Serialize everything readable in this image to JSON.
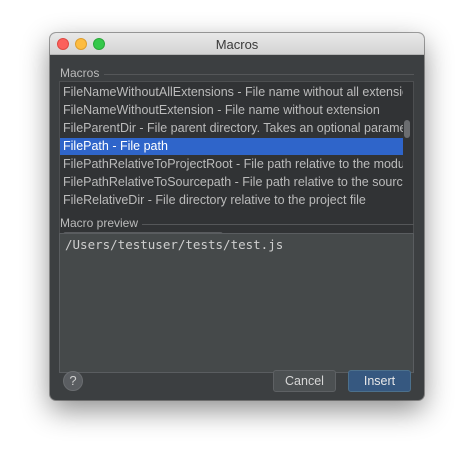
{
  "window": {
    "title": "Macros"
  },
  "macros": {
    "label": "Macros",
    "items": [
      "FileNameWithoutAllExtensions - File name without all extensio",
      "FileNameWithoutExtension - File name without extension",
      "FileParentDir - File parent directory. Takes an optional paramet",
      "FilePath - File path",
      "FilePathRelativeToProjectRoot - File path relative to the module",
      "FilePathRelativeToSourcepath - File path relative to the source",
      "FileRelativeDir - File directory relative to the project file"
    ],
    "selected_index": 3
  },
  "preview": {
    "label": "Macro preview",
    "value": "/Users/testuser/tests/test.js"
  },
  "buttons": {
    "help": "?",
    "cancel": "Cancel",
    "insert": "Insert"
  },
  "colors": {
    "selection": "#2f65ca",
    "dialog_bg": "#3c3f41",
    "default_button": "#365880"
  }
}
